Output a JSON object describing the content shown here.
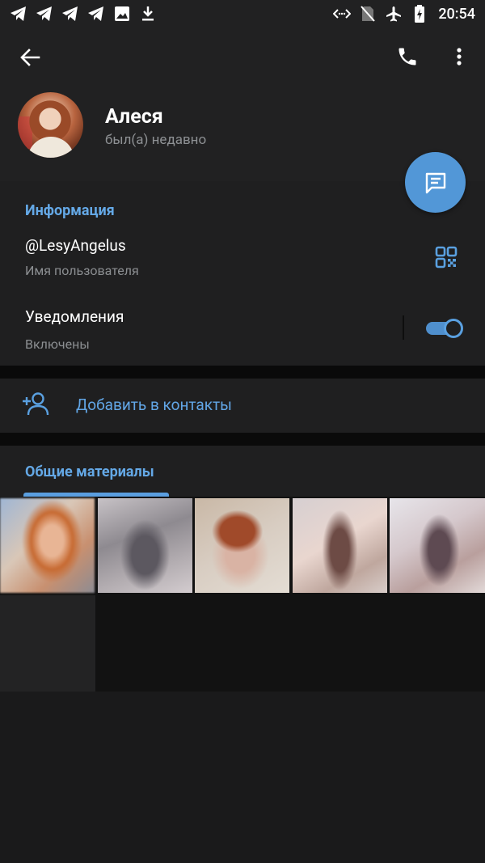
{
  "status_bar": {
    "time": "20:54",
    "left_icons": [
      "telegram-icon",
      "telegram-icon",
      "telegram-icon",
      "telegram-icon",
      "image-icon",
      "download-icon"
    ],
    "right_icons": [
      "data-saver-icon",
      "no-sim-icon",
      "airplane-icon",
      "battery-charging-icon"
    ]
  },
  "toolbar": {
    "back": "back-arrow-icon",
    "call": "phone-icon",
    "more": "more-vert-icon"
  },
  "profile": {
    "name": "Алеся",
    "status": "был(а) недавно"
  },
  "info": {
    "section_title": "Информация",
    "username": "@LesyAngelus",
    "username_label": "Имя пользователя",
    "notifications_label": "Уведомления",
    "notifications_value": "Включены",
    "notifications_enabled": true
  },
  "actions": {
    "add_contact": "Добавить в контакты"
  },
  "media": {
    "section_title": "Общие материалы",
    "thumbnail_count": 6
  },
  "colors": {
    "accent": "#5297d7",
    "link": "#64a8e6",
    "background": "#1a1a1b",
    "surface": "#1f1f20"
  }
}
